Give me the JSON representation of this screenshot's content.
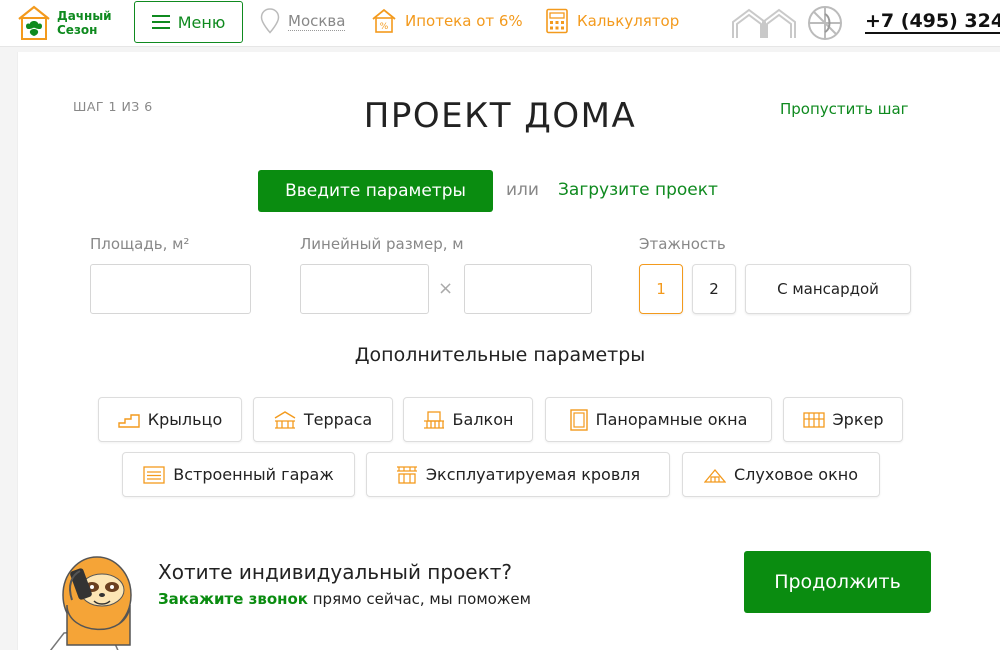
{
  "header": {
    "logo_line1": "Дачный",
    "logo_line2": "Сезон",
    "menu_label": "Меню",
    "city": "Москва",
    "mortgage_label": "Ипотека от 6%",
    "calculator_label": "Калькулятор",
    "phone": "+7 (495) 324"
  },
  "page": {
    "step": "ШАГ 1 ИЗ 6",
    "title": "ПРОЕКТ ДОМА",
    "skip": "Пропустить шаг",
    "tab_active": "Введите параметры",
    "or": "или",
    "tab_upload": "Загрузите проект"
  },
  "form": {
    "area_label": "Площадь, м²",
    "area_value": "",
    "linear_label": "Линейный размер, м",
    "length_value": "",
    "width_value": "",
    "times": "×",
    "floors_label": "Этажность",
    "floors": [
      "1",
      "2",
      "С мансардой"
    ],
    "selected_floor": "1"
  },
  "extras": {
    "title": "Дополнительные параметры",
    "items": [
      "Крыльцо",
      "Терраса",
      "Балкон",
      "Панорамные окна",
      "Эркер",
      "Встроенный гараж",
      "Эксплуатируемая кровля",
      "Слуховое окно"
    ]
  },
  "promo": {
    "title": "Хотите индивидуальный проект?",
    "link": "Закажите звонок",
    "rest": " прямо сейчас, мы поможем",
    "continue": "Продолжить"
  },
  "colors": {
    "brand_green": "#0a8c10",
    "accent_orange": "#f39a1d"
  }
}
